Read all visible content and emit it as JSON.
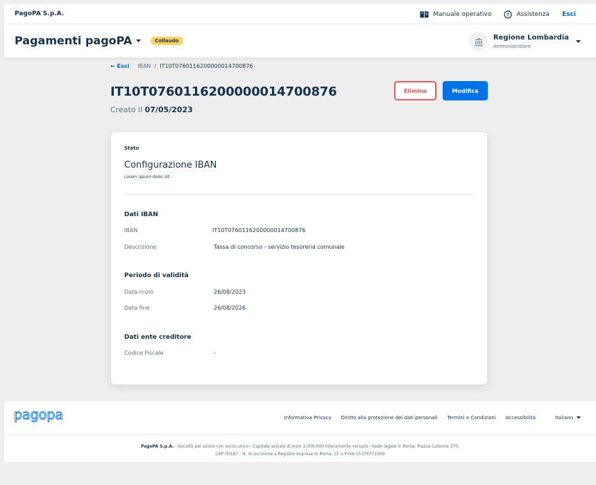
{
  "topbar": {
    "brand": "PagoPA S.p.A.",
    "manual_label": "Manuale operativo",
    "help_label": "Assistenza",
    "logout_label": "Esci"
  },
  "header": {
    "product": "Pagamenti pagoPA",
    "env_badge": "Collaudo",
    "party_name": "Regione Lombardia",
    "party_role": "Amministratore"
  },
  "breadcrumb": {
    "back": "Esci",
    "item1": "IBAN",
    "separator": "/",
    "current": "IT10T0760116200000014700876"
  },
  "page": {
    "title": "IT10T0760116200000014700876",
    "created_label": "Creato il",
    "created_date": "07/05/2023",
    "delete_label": "Elimina",
    "edit_label": "Modifica"
  },
  "card": {
    "stato_label": "Stato",
    "title": "Configurazione IBAN",
    "description": "Lorem ipsum dolor sit.",
    "section_iban": "Dati IBAN",
    "iban_label": "IBAN",
    "iban_value": "IT10T0760116200000014700876",
    "desc_label": "Descrizione",
    "desc_value": "Tassa di concorso - servizio tesoreria comunale",
    "section_period": "Periodo di validità",
    "start_label": "Data inizio",
    "start_value": "26/08/2023",
    "end_label": "Data fine",
    "end_value": "26/08/2026",
    "section_ec": "Dati ente creditore",
    "cf_label": "Codice Fiscale",
    "cf_value": "-"
  },
  "footer": {
    "logo_text": "pagopa",
    "link_privacy": "Informativa Privacy",
    "link_rights": "Diritto alla protezione dei dati personali",
    "link_terms": "Termini e Condizioni",
    "link_access": "Accessibilità",
    "language": "Italiano",
    "legal_company": "PagoPA S.p.A.",
    "legal_line1": " - Società per azioni con socio unico - Capitale sociale di euro 1,000,000 interamente versato - Sede legale in Roma, Piazza Colonna 370,",
    "legal_line2": "CAP 00187 - N. di iscrizione a Registro Imprese di Roma, CF e P.IVA 15376371009"
  },
  "colors": {
    "primary": "#0073e6",
    "danger": "#e15c5c",
    "badge": "#ffd25e",
    "text": "#17324d"
  }
}
